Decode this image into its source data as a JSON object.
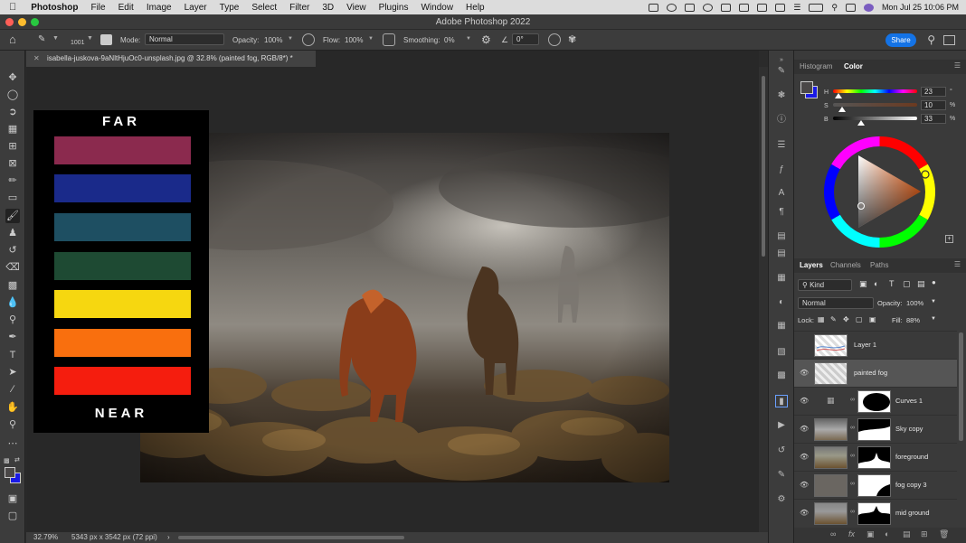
{
  "menubar": {
    "app": "Photoshop",
    "items": [
      "File",
      "Edit",
      "Image",
      "Layer",
      "Type",
      "Select",
      "Filter",
      "3D",
      "View",
      "Plugins",
      "Window",
      "Help"
    ],
    "datetime": "Mon Jul 25  10:06 PM"
  },
  "window": {
    "title": "Adobe Photoshop 2022"
  },
  "options": {
    "brush_size": "1001",
    "mode_label": "Mode:",
    "mode_value": "Normal",
    "opacity_label": "Opacity:",
    "opacity_value": "100%",
    "flow_label": "Flow:",
    "flow_value": "100%",
    "smoothing_label": "Smoothing:",
    "smoothing_value": "0%",
    "angle_value": "0°",
    "share_label": "Share"
  },
  "document": {
    "tab_title": "isabella-juskova-9aNltHjuOc0-unsplash.jpg @ 32.8% (painted fog, RGB/8*) *",
    "zoom": "32.79%",
    "dimensions": "5343 px x 3542 px (72 ppi)"
  },
  "swatches": {
    "top_label": "FAR",
    "bottom_label": "NEAR",
    "colors": [
      "#8b2a4e",
      "#1a2a8a",
      "#1e4f62",
      "#1e4a33",
      "#f6d710",
      "#f96f0e",
      "#f51d0e"
    ]
  },
  "color_panel": {
    "tabs": [
      "Histogram",
      "Color"
    ],
    "h_label": "H",
    "h_value": "23",
    "s_label": "S",
    "s_value": "10",
    "b_label": "B",
    "b_value": "33",
    "h_unit": "°",
    "s_unit": "%",
    "b_unit": "%",
    "h_level": 0.06,
    "s_level": 0.1,
    "b_level": 0.33
  },
  "layers_panel": {
    "tabs": [
      "Layers",
      "Channels",
      "Paths"
    ],
    "filter_kind": "Kind",
    "blend_mode": "Normal",
    "opacity_label": "Opacity:",
    "opacity_value": "100%",
    "lock_label": "Lock:",
    "fill_label": "Fill:",
    "fill_value": "88%",
    "layers": [
      {
        "name": "Layer 1",
        "visible": false
      },
      {
        "name": "painted fog",
        "visible": true
      },
      {
        "name": "Curves 1",
        "visible": true
      },
      {
        "name": "Sky copy",
        "visible": true
      },
      {
        "name": "foreground",
        "visible": true
      },
      {
        "name": "fog copy 3",
        "visible": true
      },
      {
        "name": "mid ground",
        "visible": true
      }
    ]
  }
}
